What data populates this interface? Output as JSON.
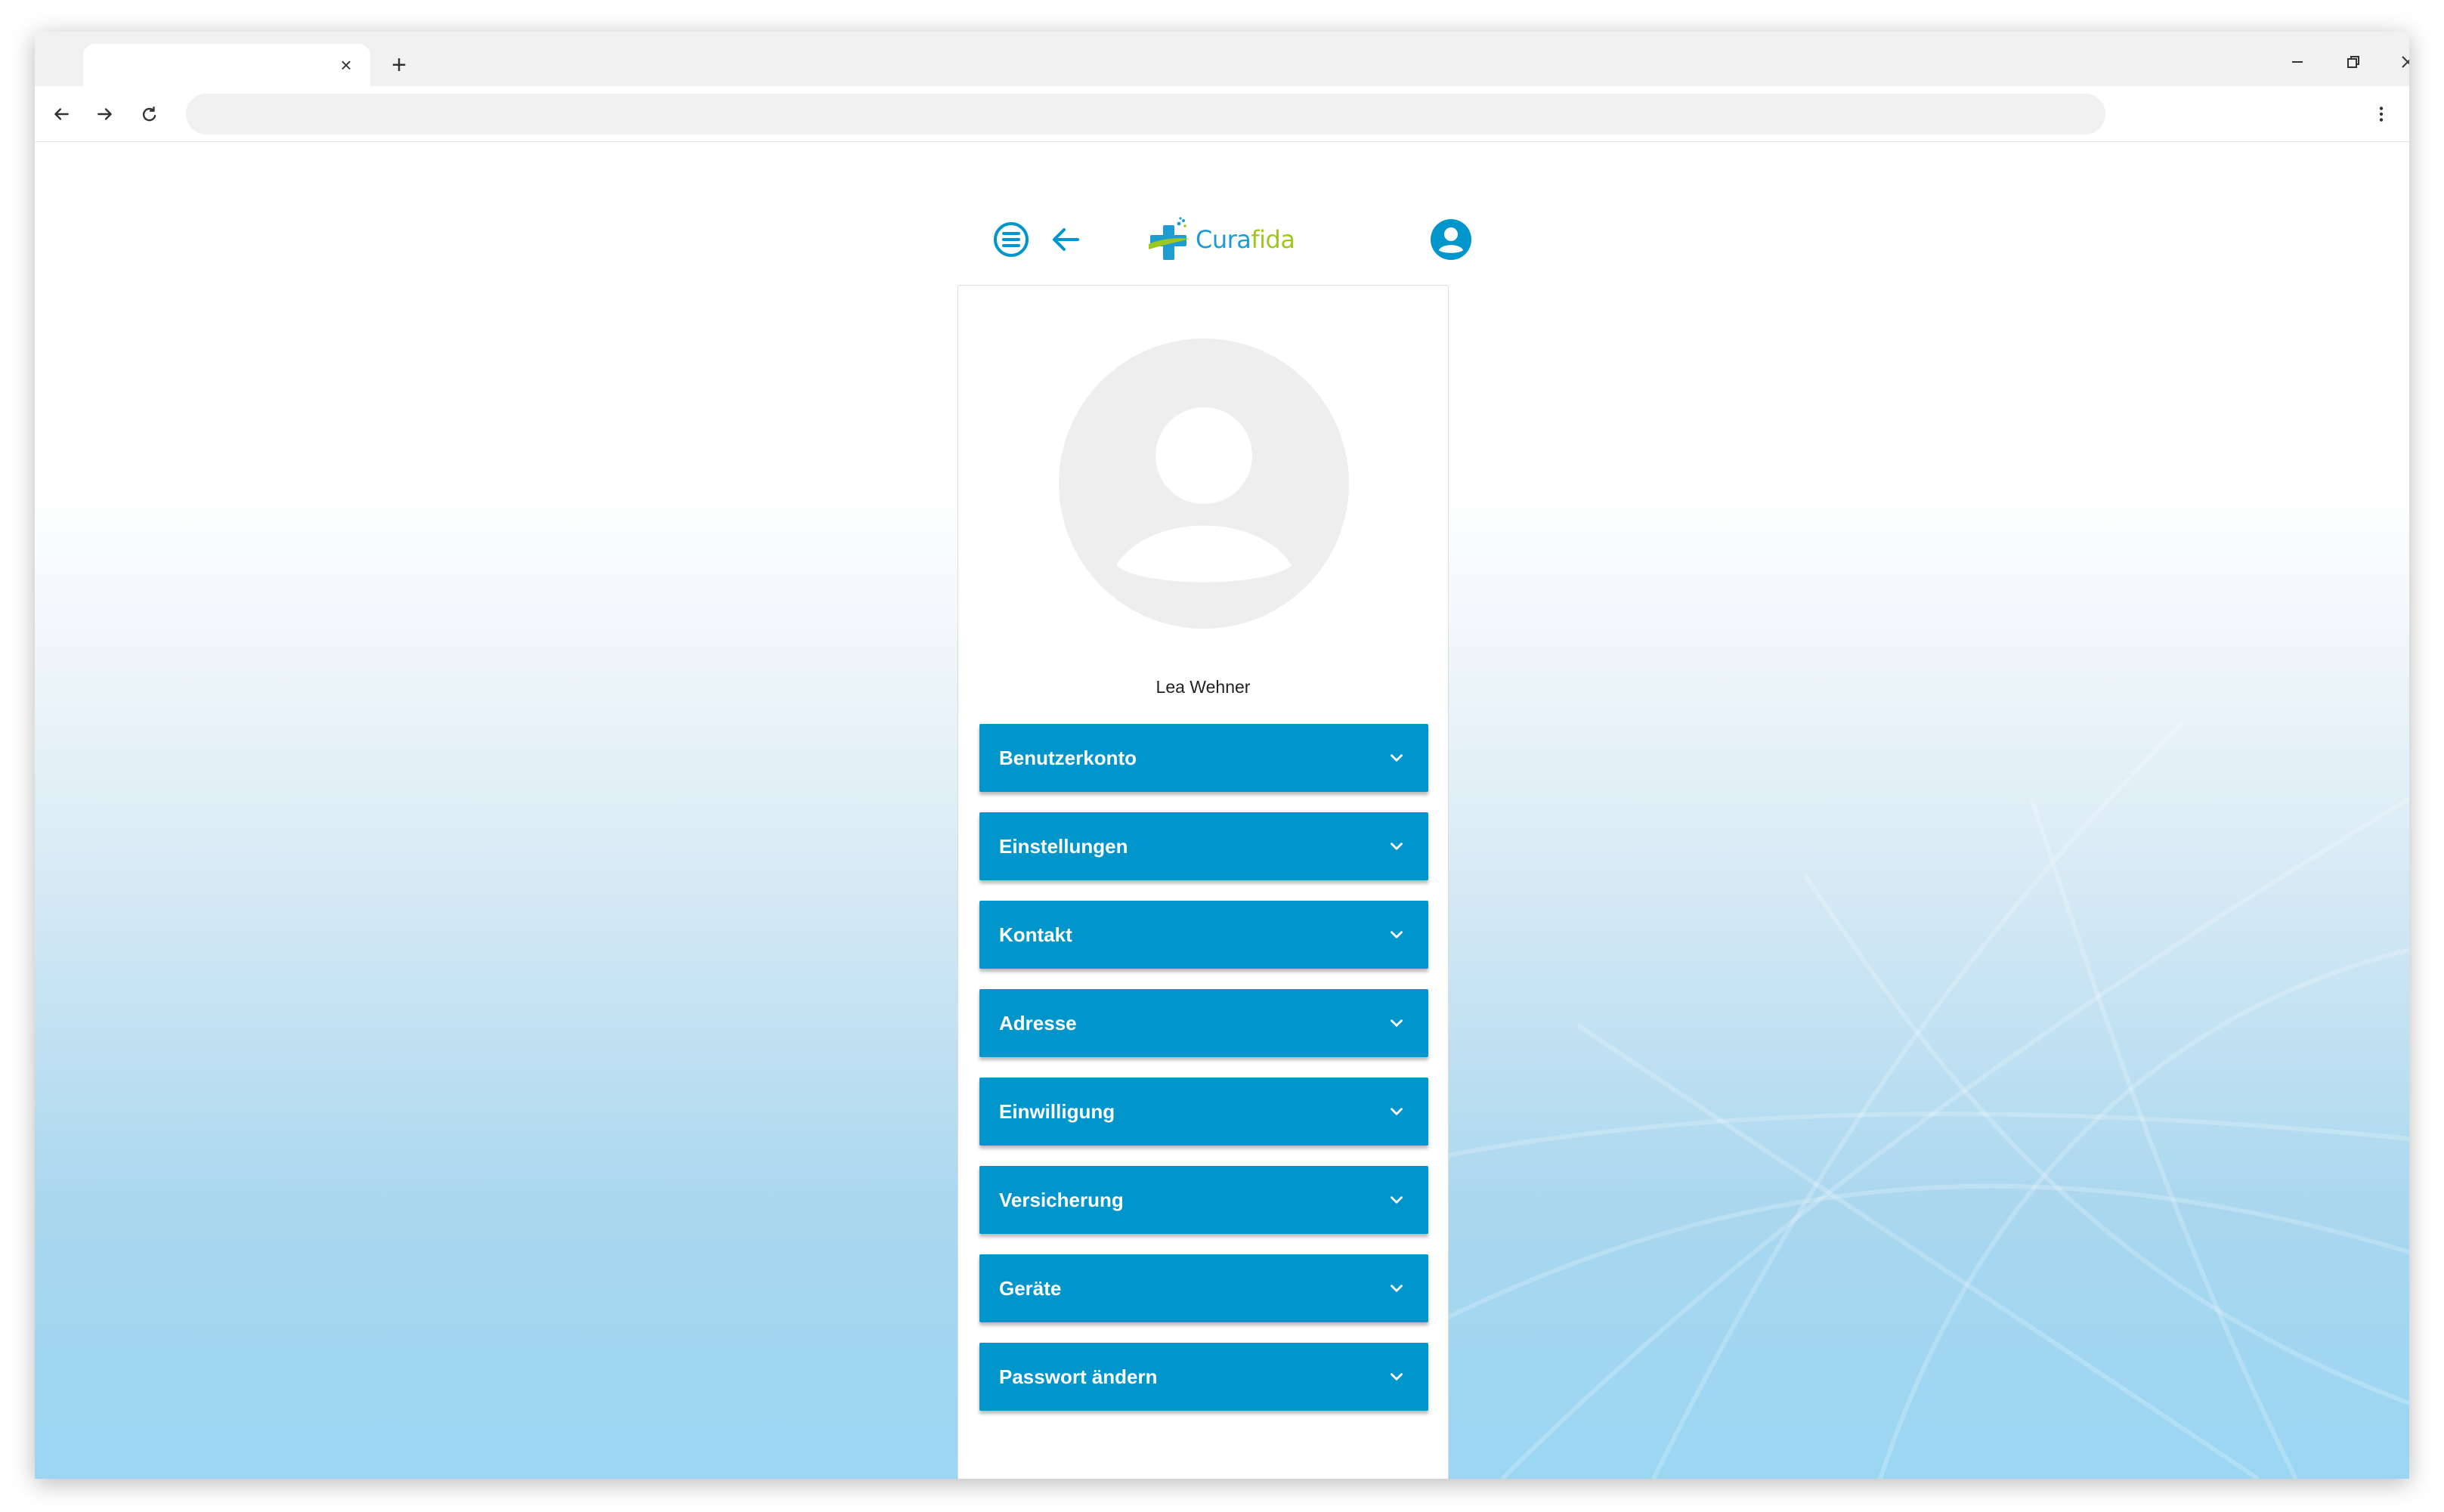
{
  "browser": {
    "tab_close_glyph": "×",
    "new_tab_glyph": "+",
    "address_value": "",
    "icons": [
      "back-icon",
      "forward-icon",
      "reload-icon",
      "more-vert-icon",
      "minimize-icon",
      "restore-icon",
      "close-icon"
    ]
  },
  "app": {
    "logo": {
      "cura": "Cura",
      "fida": "fida"
    },
    "colors": {
      "primary": "#0096cc",
      "logo_blue": "#1e9bd1",
      "logo_green": "#9cc71f",
      "avatar_bg": "#eeeeee",
      "avatar_fg": "#ffffff"
    },
    "icons": [
      "menu-icon",
      "arrow-back-icon",
      "account-circle-icon"
    ]
  },
  "profile": {
    "user_name": "Lea Wehner",
    "sections": [
      {
        "label": "Benutzerkonto"
      },
      {
        "label": "Einstellungen"
      },
      {
        "label": "Kontakt"
      },
      {
        "label": "Adresse"
      },
      {
        "label": "Einwilligung"
      },
      {
        "label": "Versicherung"
      },
      {
        "label": "Geräte"
      },
      {
        "label": "Passwort ändern"
      }
    ]
  }
}
